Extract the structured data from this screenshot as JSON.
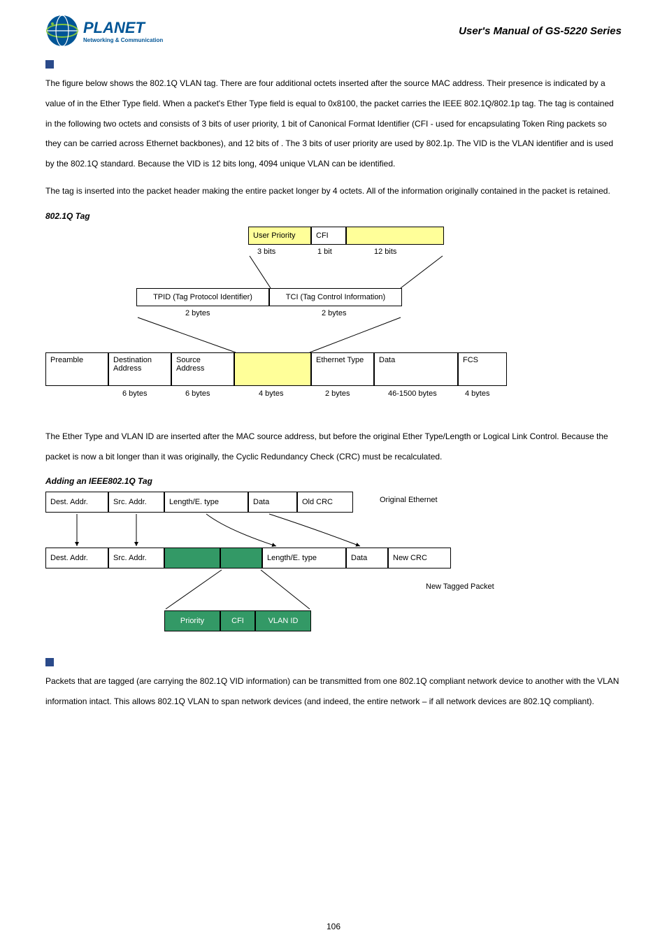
{
  "header": {
    "brand": "PLANET",
    "tagline": "Networking & Communication",
    "manual_title": "User's Manual of GS-5220 Series"
  },
  "intro": {
    "p1": "The figure below shows the 802.1Q VLAN tag. There are four additional octets inserted after the source MAC address. Their presence is indicated by a value of               in the Ether Type field. When a packet's Ether Type field is equal to 0x8100, the packet carries the IEEE 802.1Q/802.1p tag. The tag is contained in the following two octets and consists of 3 bits of user priority, 1 bit of Canonical Format Identifier (CFI - used for encapsulating Token Ring packets so they can be carried across Ethernet backbones), and 12 bits of                          . The 3 bits of user priority are used by 802.1p. The VID is the VLAN identifier and is used by the 802.1Q standard. Because the VID is 12 bits long, 4094 unique VLAN can be identified.",
    "p2": "The tag is inserted into the packet header making the entire packet longer by 4 octets. All of the information originally contained in the packet is retained."
  },
  "fig1": {
    "title": "802.1Q Tag",
    "row1": {
      "user_priority": "User Priority",
      "cfi": "CFI",
      "bits3": "3 bits",
      "bit1": "1 bit",
      "bits12": "12 bits"
    },
    "row2": {
      "tpid": "TPID (Tag Protocol Identifier)",
      "tci": "TCI (Tag Control Information)",
      "b2a": "2 bytes",
      "b2b": "2 bytes"
    },
    "row3": {
      "preamble": "Preamble",
      "dest": "Destination Address",
      "src": "Source Address",
      "eth": "Ethernet Type",
      "data": "Data",
      "fcs": "FCS",
      "b6a": "6 bytes",
      "b6b": "6 bytes",
      "b4": "4 bytes",
      "b2": "2 bytes",
      "b46": "46-1500 bytes",
      "b4b": "4 bytes"
    }
  },
  "mid": {
    "p1": "The Ether Type and VLAN ID are inserted after the MAC source address, but before the original Ether Type/Length or Logical Link Control. Because the packet is now a bit longer than it was originally, the Cyclic Redundancy Check (CRC) must be recalculated."
  },
  "fig2": {
    "title": "Adding an IEEE802.1Q Tag",
    "top": {
      "dest": "Dest. Addr.",
      "src": "Src. Addr.",
      "len": "Length/E. type",
      "data": "Data",
      "crc": "Old CRC",
      "label": "Original Ethernet"
    },
    "bot": {
      "dest": "Dest. Addr.",
      "src": "Src. Addr.",
      "len": "Length/E. type",
      "data": "Data",
      "crc": "New CRC",
      "label": "New Tagged Packet"
    },
    "tag": {
      "priority": "Priority",
      "cfi": "CFI",
      "vlan": "VLAN ID"
    }
  },
  "end": {
    "p1": "Packets that are tagged (are carrying the 802.1Q VID information) can be transmitted from one 802.1Q compliant network device to another with the VLAN information intact. This allows 802.1Q VLAN to span network devices (and indeed, the entire network – if all network devices are 802.1Q compliant)."
  },
  "page_num": "106"
}
